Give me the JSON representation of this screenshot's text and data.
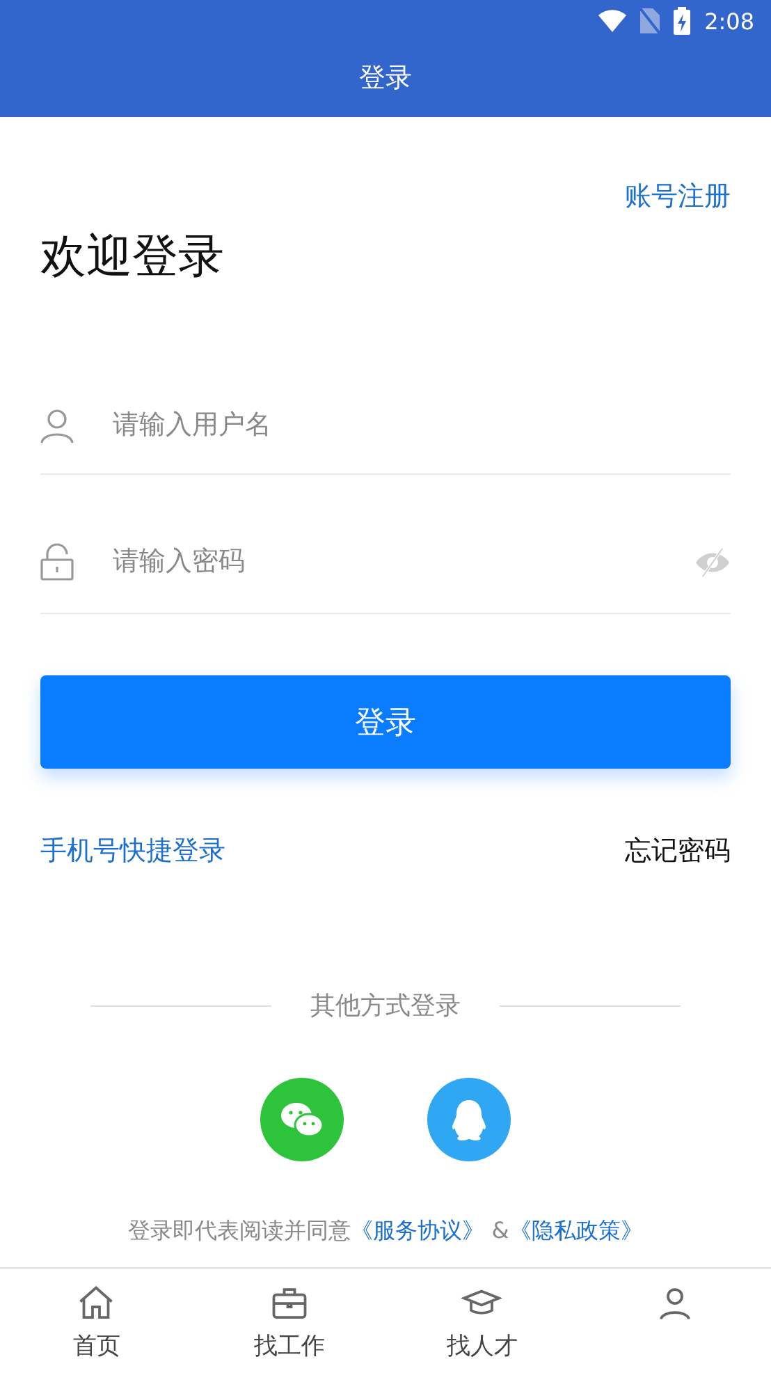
{
  "status_bar": {
    "time": "2:08"
  },
  "header": {
    "title": "登录"
  },
  "register_link": "账号注册",
  "heading": "欢迎登录",
  "fields": [
    {
      "kind": "user",
      "placeholder": "请输入用户名"
    },
    {
      "kind": "password",
      "placeholder": "请输入密码"
    }
  ],
  "login_button": "登录",
  "phone_login_link": "手机号快捷登录",
  "forgot_password_link": "忘记密码",
  "other_methods_label": "其他方式登录",
  "social_buttons": [
    {
      "kind": "wechat",
      "color": "#2dc43b"
    },
    {
      "kind": "qq",
      "color": "#2fa7f2"
    }
  ],
  "agreement": {
    "prefix": "登录即代表阅读并同意",
    "links": [
      {
        "text": "《服务协议》"
      },
      {
        "text": "《隐私政策》"
      }
    ],
    "separator": " &"
  },
  "tabs": [
    {
      "kind": "home",
      "label": "首页"
    },
    {
      "kind": "briefcase",
      "label": "找工作"
    },
    {
      "kind": "cap",
      "label": "找人才"
    },
    {
      "kind": "person"
    }
  ]
}
